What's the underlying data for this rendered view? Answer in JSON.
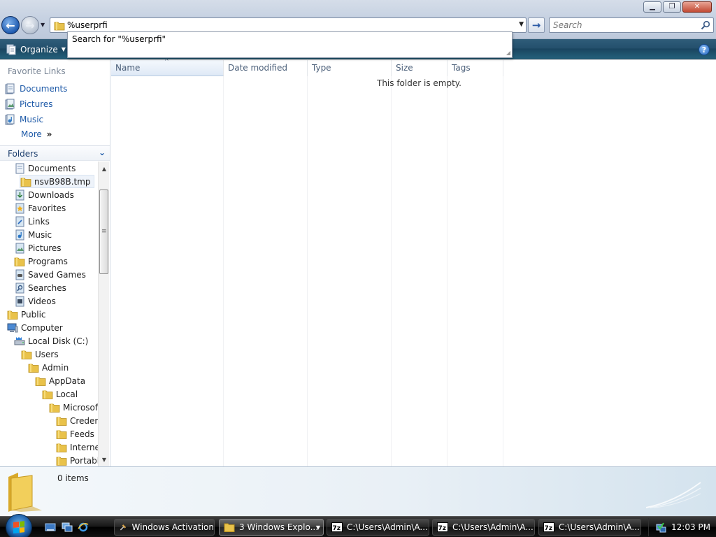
{
  "window": {
    "minimize_glyph": "▁",
    "maximize_glyph": "❐",
    "close_glyph": "✕"
  },
  "nav": {
    "back_glyph": "←",
    "forward_glyph": "→",
    "history_glyph": "▼"
  },
  "address": {
    "value": "%userprfi",
    "dropdown_glyph": "▼",
    "go_glyph": "→",
    "suggestion": "Search for \"%userprfi\""
  },
  "search": {
    "placeholder": "Search"
  },
  "toolbar": {
    "organize_label": "Organize",
    "organize_caret": "▼",
    "help_glyph": "?"
  },
  "favorites": {
    "header": "Favorite Links",
    "links": [
      {
        "label": "Documents"
      },
      {
        "label": "Pictures"
      },
      {
        "label": "Music"
      }
    ],
    "more_label": "More",
    "more_chevron": "»"
  },
  "folders": {
    "header": "Folders",
    "header_chevron": "⌄",
    "tree": [
      {
        "label": "Documents",
        "icon": "documents-icon"
      },
      {
        "label": "nsvB98B.tmp",
        "icon": "folder-icon",
        "selected": true
      },
      {
        "label": "Downloads",
        "icon": "downloads-icon"
      },
      {
        "label": "Favorites",
        "icon": "favorites-icon"
      },
      {
        "label": "Links",
        "icon": "links-icon"
      },
      {
        "label": "Music",
        "icon": "music-icon"
      },
      {
        "label": "Pictures",
        "icon": "pictures-icon"
      },
      {
        "label": "Programs",
        "icon": "folder-icon"
      },
      {
        "label": "Saved Games",
        "icon": "saved-games-icon"
      },
      {
        "label": "Searches",
        "icon": "searches-icon"
      },
      {
        "label": "Videos",
        "icon": "videos-icon"
      },
      {
        "label": "Public",
        "icon": "folder-icon"
      },
      {
        "label": "Computer",
        "icon": "computer-icon"
      },
      {
        "label": "Local Disk (C:)",
        "icon": "local-disk-icon"
      },
      {
        "label": "Users",
        "icon": "folder-icon"
      },
      {
        "label": "Admin",
        "icon": "folder-icon"
      },
      {
        "label": "AppData",
        "icon": "folder-icon"
      },
      {
        "label": "Local",
        "icon": "folder-icon"
      },
      {
        "label": "Microsof",
        "icon": "folder-icon"
      },
      {
        "label": "Creden",
        "icon": "folder-icon"
      },
      {
        "label": "Feeds",
        "icon": "folder-icon"
      },
      {
        "label": "Interne",
        "icon": "folder-icon"
      },
      {
        "label": "Portabl",
        "icon": "folder-icon"
      }
    ],
    "scroll_up": "▲",
    "scroll_down": "▼",
    "scroll_grip": "≡"
  },
  "columns": {
    "headers": [
      "Name",
      "Date modified",
      "Type",
      "Size",
      "Tags"
    ],
    "sort_glyph": "^"
  },
  "content": {
    "empty_message": "This folder is empty."
  },
  "details": {
    "item_count": "0 items"
  },
  "taskbar": {
    "tasks": [
      {
        "label": "Windows Activation",
        "icon": "windows-activation-icon"
      },
      {
        "label": "3 Windows Explo...",
        "icon": "explorer-folder-icon",
        "active": true
      },
      {
        "label": "C:\\Users\\Admin\\A...",
        "icon": "7zip-icon"
      },
      {
        "label": "C:\\Users\\Admin\\A...",
        "icon": "7zip-icon"
      },
      {
        "label": "C:\\Users\\Admin\\A...",
        "icon": "7zip-icon"
      }
    ],
    "group_arrow": "▼",
    "clock": "12:03 PM"
  }
}
